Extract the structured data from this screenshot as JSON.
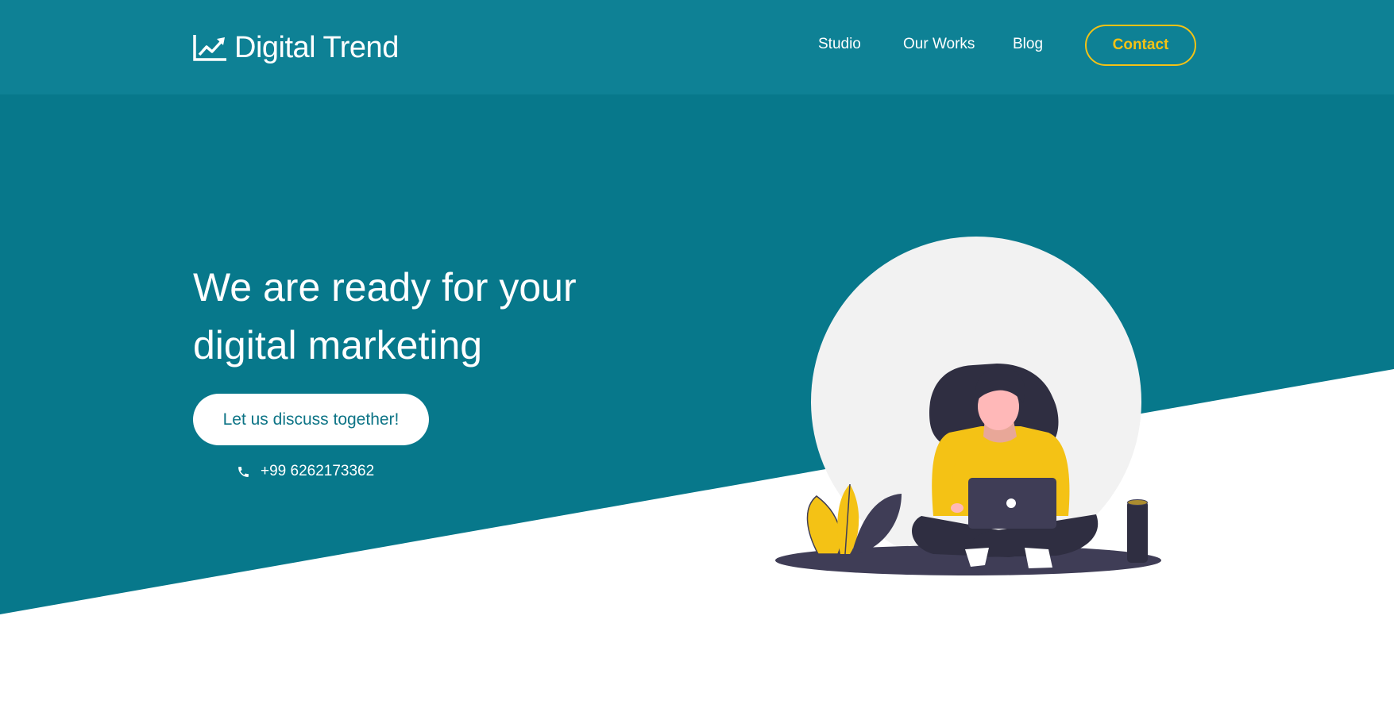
{
  "colors": {
    "navbar_bg": "#0e8195",
    "hero_bg": "#07788b",
    "accent_yellow": "#f4c215",
    "button_text": "#0d7486"
  },
  "header": {
    "brand_icon": "trending-up-chart-icon",
    "brand_name": "Digital Trend",
    "nav": [
      {
        "label": "Studio"
      },
      {
        "label": "Our Works"
      },
      {
        "label": "Blog"
      }
    ],
    "contact_label": "Contact"
  },
  "hero": {
    "headline_line1": "We are ready for your",
    "headline_line2": "digital marketing",
    "cta_label": "Let us discuss together!",
    "phone_icon": "phone-icon",
    "phone": "+99 6262173362",
    "illustration": "woman-with-laptop-illustration"
  }
}
